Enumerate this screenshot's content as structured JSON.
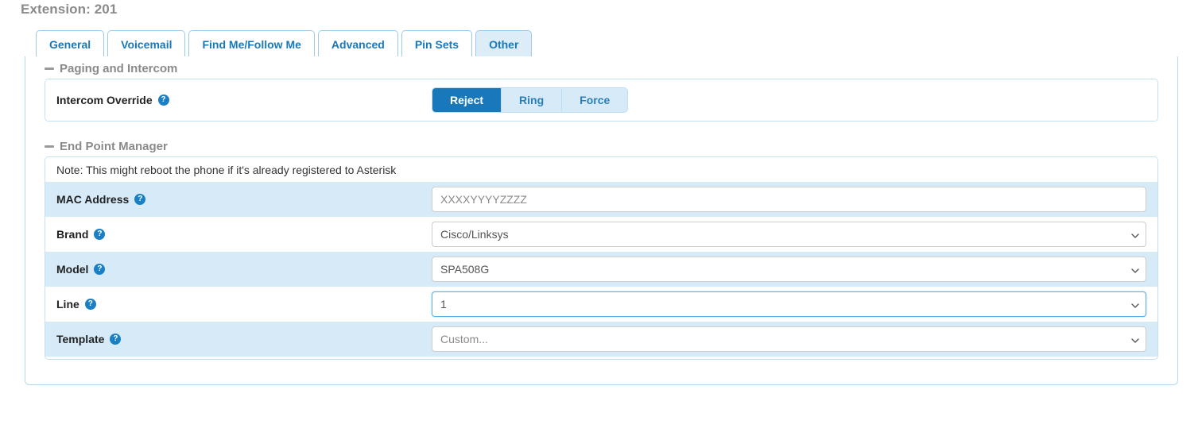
{
  "page": {
    "title": "Extension: 201"
  },
  "tabs": [
    {
      "label": "General",
      "active": false
    },
    {
      "label": "Voicemail",
      "active": false
    },
    {
      "label": "Find Me/Follow Me",
      "active": false
    },
    {
      "label": "Advanced",
      "active": false
    },
    {
      "label": "Pin Sets",
      "active": false
    },
    {
      "label": "Other",
      "active": true
    }
  ],
  "sections": {
    "paging": {
      "heading": "Paging and Intercom",
      "collapse_icon": "minus-icon",
      "intercom_override": {
        "label": "Intercom Override",
        "help_icon": "question-mark-icon",
        "options": [
          {
            "label": "Reject",
            "active": true
          },
          {
            "label": "Ring",
            "active": false
          },
          {
            "label": "Force",
            "active": false
          }
        ]
      }
    },
    "endpoint_manager": {
      "heading": "End Point Manager",
      "collapse_icon": "minus-icon",
      "note": "Note: This might reboot the phone if it's already registered to Asterisk",
      "fields": [
        {
          "label": "MAC Address",
          "help_icon": "question-mark-icon",
          "type": "text",
          "value": "",
          "placeholder": "XXXXYYYYZZZZ",
          "shaded": true,
          "focused": false
        },
        {
          "label": "Brand",
          "help_icon": "question-mark-icon",
          "type": "select",
          "value": "Cisco/Linksys",
          "is_placeholder": false,
          "shaded": false,
          "focused": false
        },
        {
          "label": "Model",
          "help_icon": "question-mark-icon",
          "type": "select",
          "value": "SPA508G",
          "is_placeholder": false,
          "shaded": true,
          "focused": false
        },
        {
          "label": "Line",
          "help_icon": "question-mark-icon",
          "type": "select",
          "value": "1",
          "is_placeholder": false,
          "shaded": false,
          "focused": true
        },
        {
          "label": "Template",
          "help_icon": "question-mark-icon",
          "type": "select",
          "value": "Custom...",
          "is_placeholder": true,
          "shaded": true,
          "focused": false
        }
      ]
    }
  },
  "colors": {
    "accent": "#1878b9",
    "tab_active_bg": "#dcedf8",
    "row_shaded_bg": "#d6eaf8",
    "panel_border": "#c4e0f2",
    "title_gray": "#8a8a8a",
    "focus_border": "#5faee3"
  }
}
